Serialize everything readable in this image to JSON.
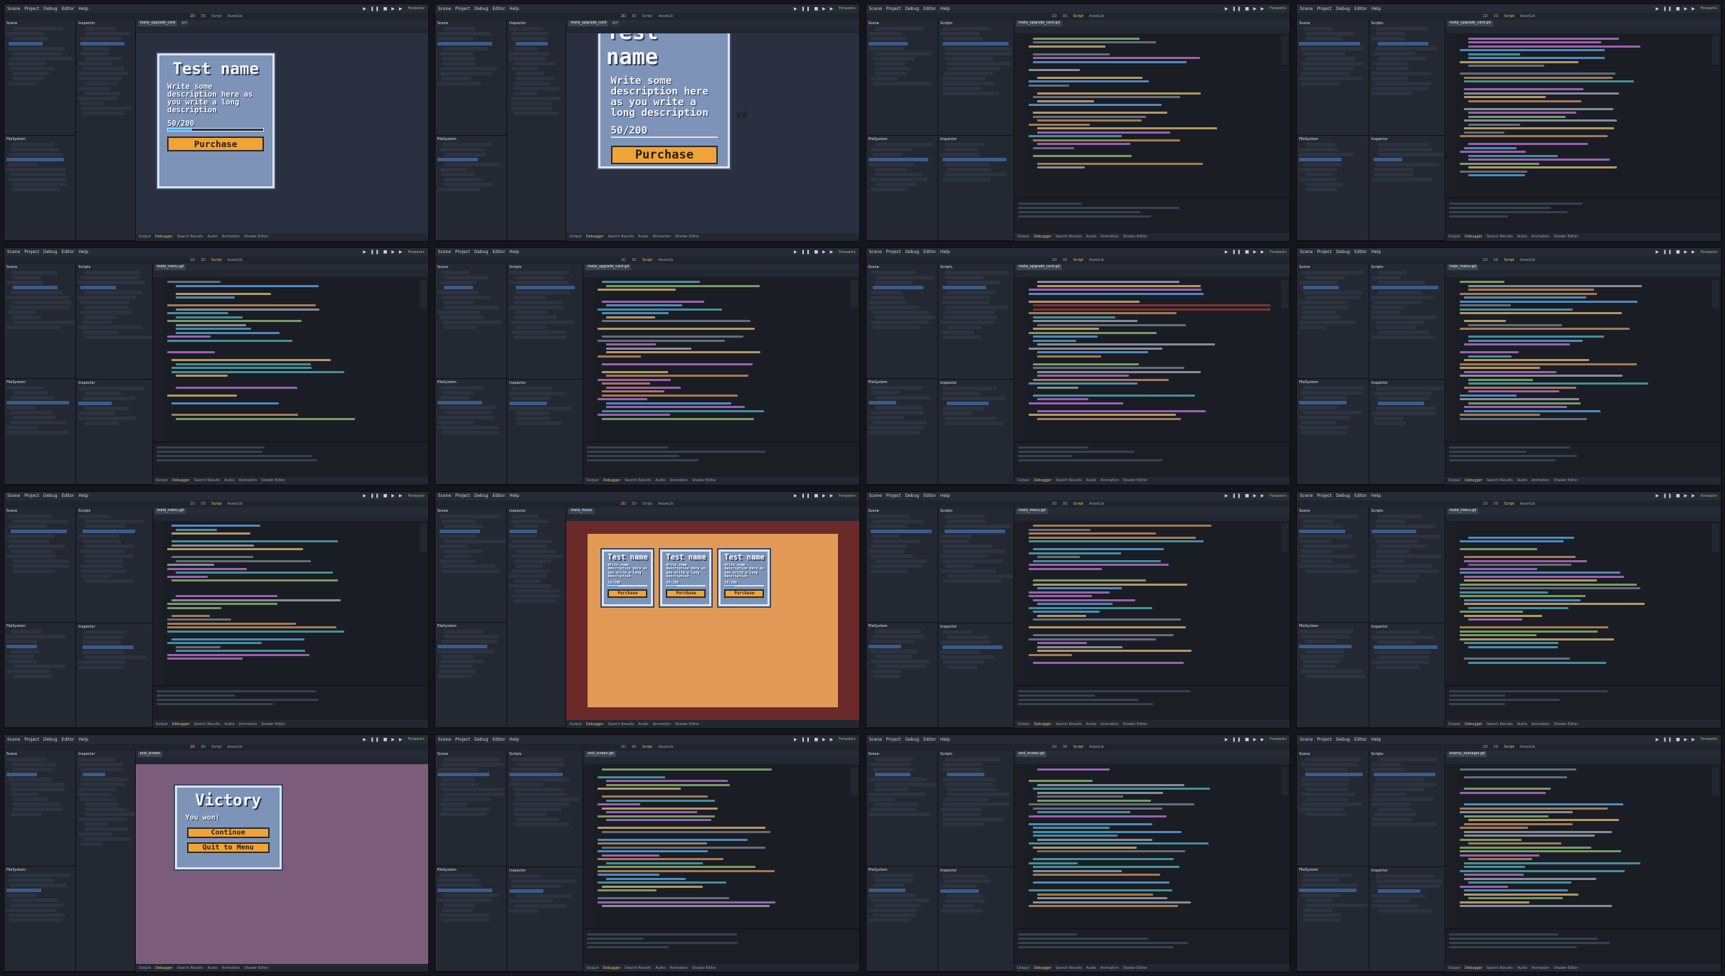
{
  "editor": {
    "menus": [
      "Scene",
      "Project",
      "Debug",
      "Editor",
      "Help"
    ],
    "workspaces": [
      "2D",
      "3D",
      "Script",
      "AssetLib"
    ],
    "renderer": "Forward+",
    "bottom_tabs": [
      "Output",
      "Debugger",
      "Search Results",
      "Audio",
      "Animation",
      "Shader Editor"
    ]
  },
  "frames": [
    {
      "id": 1,
      "kind": "canvas",
      "active_ws": "2D",
      "tabs": [
        "meta_upgrade_card",
        "gui"
      ]
    },
    {
      "id": 2,
      "kind": "canvas-zoom",
      "active_ws": "2D",
      "tabs": [
        "meta_upgrade_card",
        "gui"
      ]
    },
    {
      "id": 3,
      "kind": "code",
      "active_ws": "Script",
      "tabs": [
        "meta_upgrade_card.gd"
      ]
    },
    {
      "id": 4,
      "kind": "code",
      "active_ws": "Script",
      "tabs": [
        "meta_upgrade_card.gd"
      ]
    },
    {
      "id": 5,
      "kind": "code",
      "active_ws": "Script",
      "tabs": [
        "meta_menu.gd"
      ]
    },
    {
      "id": 6,
      "kind": "code",
      "active_ws": "Script",
      "tabs": [
        "meta_upgrade_card.gd"
      ]
    },
    {
      "id": 7,
      "kind": "code-error",
      "active_ws": "Script",
      "tabs": [
        "meta_upgrade_card.gd"
      ]
    },
    {
      "id": 8,
      "kind": "code",
      "active_ws": "Script",
      "tabs": [
        "main_menu.gd"
      ]
    },
    {
      "id": 9,
      "kind": "code",
      "active_ws": "Script",
      "tabs": [
        "meta_menu.gd"
      ]
    },
    {
      "id": 10,
      "kind": "canvas-grid",
      "active_ws": "2D",
      "tabs": [
        "meta_menu"
      ]
    },
    {
      "id": 11,
      "kind": "code",
      "active_ws": "Script",
      "tabs": [
        "meta_menu.gd"
      ]
    },
    {
      "id": 12,
      "kind": "code",
      "active_ws": "Script",
      "tabs": [
        "meta_menu.gd"
      ]
    },
    {
      "id": 13,
      "kind": "canvas-victory",
      "active_ws": "2D",
      "tabs": [
        "end_screen"
      ]
    },
    {
      "id": 14,
      "kind": "code",
      "active_ws": "Script",
      "tabs": [
        "end_screen.gd"
      ]
    },
    {
      "id": 15,
      "kind": "code",
      "active_ws": "Script",
      "tabs": [
        "end_screen.gd"
      ]
    },
    {
      "id": 16,
      "kind": "code",
      "active_ws": "Script",
      "tabs": [
        "enemy_manager.gd"
      ]
    }
  ],
  "card": {
    "title": "Test name",
    "description": "Write some description here as you write a long description",
    "progress_label": "50/200",
    "progress": 0.25,
    "quantity": "x0",
    "button_label": "Purchase"
  },
  "victory": {
    "title": "Victory",
    "subtitle": "You won!",
    "continue_label": "Continue",
    "quit_label": "Quit to Menu"
  },
  "colors": {
    "accent": "#e9c66b",
    "card_bg": "#7d93b8",
    "button": "#f0a436",
    "canvas_bg": "#2b3040",
    "grid_bg": "#e29a56",
    "victory_bg": "#7b5d7b",
    "error_line": "#7a3434"
  }
}
